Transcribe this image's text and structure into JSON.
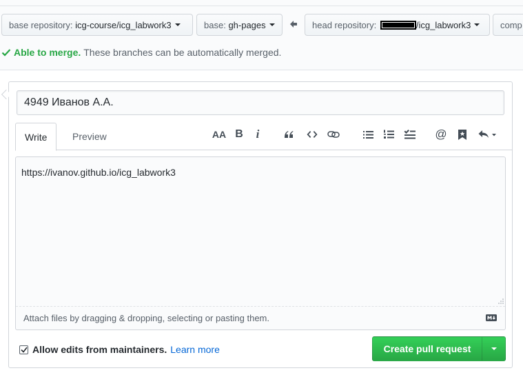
{
  "compare": {
    "base_repo_label": "base repository:",
    "base_repo_value": "icg-course/icg_labwork3",
    "base_branch_label": "base:",
    "base_branch_value": "gh-pages",
    "head_repo_label": "head repository:",
    "head_repo_value": "/icg_labwork3",
    "compare_label": "comp"
  },
  "merge": {
    "status": "Able to merge.",
    "message": "These branches can be automatically merged."
  },
  "form": {
    "title_value": "4949 Иванов А.А.",
    "tabs": [
      {
        "label": "Write",
        "active": true
      },
      {
        "label": "Preview",
        "active": false
      }
    ],
    "toolbar_icons": [
      "text-size-icon",
      "bold-icon",
      "italic-icon",
      "quote-icon",
      "code-icon",
      "link-icon",
      "unordered-list-icon",
      "ordered-list-icon",
      "task-list-icon",
      "mention-icon",
      "bookmark-icon",
      "reply-icon"
    ],
    "toolbar_text": {
      "heading": "AA",
      "bold": "B",
      "italic": "i",
      "mention": "@"
    },
    "body_value": "https://ivanov.github.io/icg_labwork3",
    "attach_hint": "Attach files by dragging & dropping, selecting or pasting them.",
    "allow_edits_label": "Allow edits from maintainers.",
    "allow_edits_checked": true,
    "learn_more": "Learn more",
    "create_button": "Create pull request"
  },
  "colors": {
    "accent_green": "#28a745",
    "link_blue": "#0366d6"
  }
}
